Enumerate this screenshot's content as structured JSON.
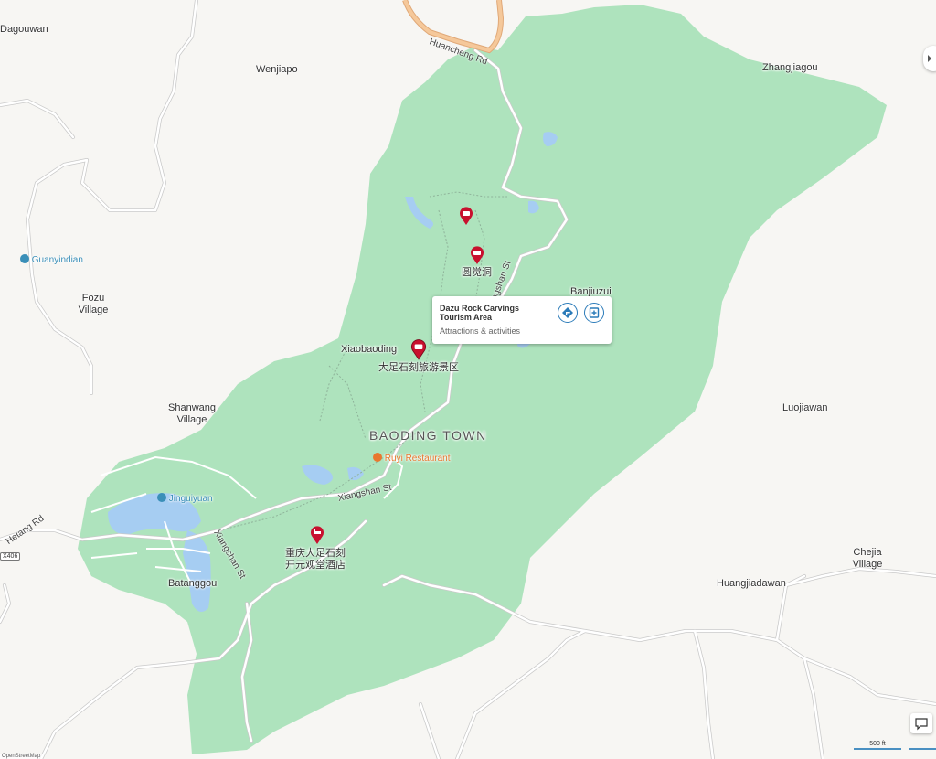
{
  "map": {
    "colors": {
      "park": "#aee3bd",
      "water": "#a6cdf2",
      "road": "#ffffff",
      "road_casing": "#c9c9c9",
      "highway": "#f5c89a",
      "pin": "#c8102e"
    },
    "places": {
      "dagouwan": "Dagouwan",
      "wenjiapo": "Wenjiapo",
      "zhangjiagou": "Zhangjiagou",
      "fozu": "Fozu Village",
      "shanwang": "Shanwang Village",
      "luojiawan": "Luojiawan",
      "chejia": "Chejia Village",
      "huangjiadawan": "Huangjiadawan",
      "batanggou": "Batanggou",
      "banjiuzui": "Banjiuzui",
      "xiaobaoding": "Xiaobaoding",
      "baoding_town": "BAODING TOWN"
    },
    "pois": {
      "guanyindian": "Guanyindian",
      "jinguiyuan": "Jinguiyuan",
      "ruyi": "Ruyi Restaurant",
      "yuanjuedong": "圆觉洞",
      "dazu_scenic": "大足石刻旅游景区",
      "hotel": "重庆大足石刻\n开元观堂酒店"
    },
    "roads": {
      "huancheng": "Huancheng Rd",
      "hetang": "Hetang Rd",
      "xiangshan_1": "Xiangshan St",
      "xiangshan_2": "Xiangshan St",
      "xiangshan_3": "Xiangshan St",
      "route_shield": "X406"
    },
    "popup": {
      "title": "Dazu Rock Carvings Tourism Area",
      "category": "Attractions & activities",
      "directions_icon": "directions-icon",
      "save_icon": "save-icon"
    },
    "scale": {
      "label": "500 ft"
    },
    "credit": "OpenStreetMap"
  }
}
